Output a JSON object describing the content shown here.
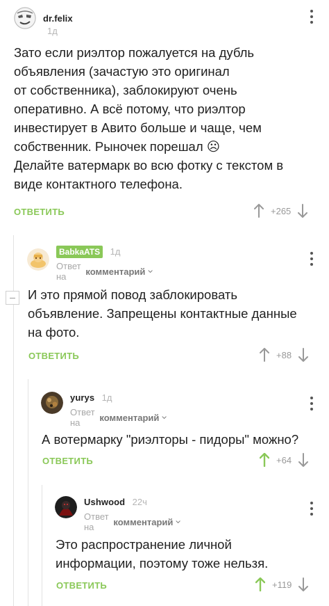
{
  "comments": [
    {
      "author": "dr.felix",
      "time": "1д",
      "text_lines": [
        "Зато если риэлтор пожалуется на дубль",
        "объявления (зачастую это оригинал",
        "от собственника), заблокируют очень",
        "оперативно. А всё потому, что риэлтор",
        "инвестирует в Авито больше и чаще, чем",
        "собственник. Рыночек порешал ☹",
        "Делайте ватермарк во всю фотку с текстом в",
        "виде контактного телефона."
      ],
      "reply_label": "ОТВЕТИТЬ",
      "score": "+265"
    },
    {
      "author": "BabkaATS",
      "time": "1д",
      "reply_to_prefix": "Ответ на",
      "reply_to_target": "комментарий",
      "text_lines": [
        "И это прямой повод заблокировать",
        "объявление. Запрещены контактные данные",
        "на фото."
      ],
      "reply_label": "ОТВЕТИТЬ",
      "score": "+88"
    },
    {
      "author": "yurys",
      "time": "1д",
      "reply_to_prefix": "Ответ на",
      "reply_to_target": "комментарий",
      "text_lines": [
        "А вотермарку \"риэлторы - пидоры\" можно?"
      ],
      "reply_label": "ОТВЕТИТЬ",
      "score": "+64",
      "upvoted": true
    },
    {
      "author": "Ushwood",
      "time": "22ч",
      "reply_to_prefix": "Ответ на",
      "reply_to_target": "комментарий",
      "text_lines": [
        "Это распространение личной",
        "информации, поэтому тоже нельзя."
      ],
      "reply_label": "ОТВЕТИТЬ",
      "score": "+119",
      "upvoted": true
    }
  ],
  "colors": {
    "accent": "#8ac858",
    "muted": "#999999",
    "text": "#1f1f1f"
  }
}
